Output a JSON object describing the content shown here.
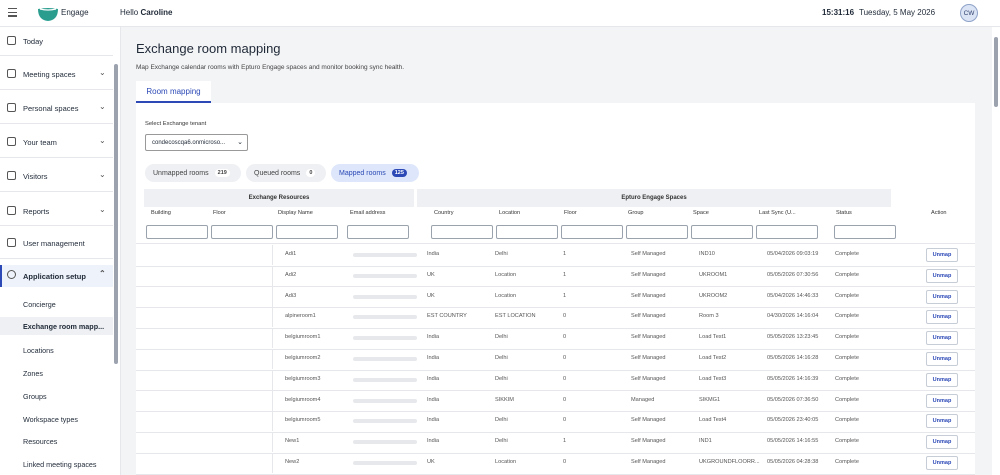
{
  "header": {
    "brand": "Engage",
    "greeting": "Hello",
    "user_name": "Caroline",
    "time": "15:31:16",
    "date": "Tuesday, 5 May 2026",
    "avatar_initials": "CW",
    "accent": "#2c49b6",
    "logo_color": "#2a9d8f"
  },
  "sidebar": {
    "items": [
      {
        "label": "Today",
        "icon": "calendar-icon",
        "chev": ""
      },
      {
        "label": "Meeting spaces",
        "icon": "door-icon",
        "chev": "⌄"
      },
      {
        "label": "Personal spaces",
        "icon": "desk-icon",
        "chev": "⌄"
      },
      {
        "label": "Your team",
        "icon": "team-icon",
        "chev": "⌄"
      },
      {
        "label": "Visitors",
        "icon": "visitor-icon",
        "chev": "⌄"
      },
      {
        "label": "Reports",
        "icon": "report-icon",
        "chev": "⌄"
      },
      {
        "label": "User management",
        "icon": "user-icon",
        "chev": ""
      },
      {
        "label": "Application setup",
        "icon": "gear-icon",
        "chev": "⌃"
      }
    ],
    "sub_items": [
      "Concierge",
      "Exchange room mapp...",
      "Locations",
      "Zones",
      "Groups",
      "Workspace types",
      "Resources",
      "Linked meeting spaces"
    ]
  },
  "page": {
    "title": "Exchange room mapping",
    "subtitle": "Map Exchange calendar rooms with Epturo Engage spaces and monitor booking sync health.",
    "tab": "Room mapping"
  },
  "tenant": {
    "label": "Select Exchange tenant",
    "value": "condecoscqa6.onmicroso..."
  },
  "pills": [
    {
      "label": "Unmapped rooms",
      "count": "219"
    },
    {
      "label": "Queued rooms",
      "count": "0"
    },
    {
      "label": "Mapped rooms",
      "count": "125"
    }
  ],
  "groups": {
    "left": "Exchange Resources",
    "right": "Epturo Engage Spaces"
  },
  "columns": [
    "Building",
    "Floor",
    "Display Name",
    "Email address",
    "Country",
    "Location",
    "Floor",
    "Group",
    "Space",
    "Last Sync (U...",
    "Status",
    "Action"
  ],
  "action_label": "Unmap",
  "rows": [
    {
      "name": "Adi1",
      "country": "India",
      "location": "Delhi",
      "floor": "1",
      "group": "Self Managed",
      "space": "IND10",
      "sync": "05/04/2026 09:03:19",
      "status": "Complete"
    },
    {
      "name": "Adi2",
      "country": "UK",
      "location": "Location",
      "floor": "1",
      "group": "Self Managed",
      "space": "UKROOM1",
      "sync": "05/05/2026 07:30:56",
      "status": "Complete"
    },
    {
      "name": "Adi3",
      "country": "UK",
      "location": "Location",
      "floor": "1",
      "group": "Self Managed",
      "space": "UKROOM2",
      "sync": "05/04/2026 14:46:33",
      "status": "Complete"
    },
    {
      "name": "alpineroom1",
      "country": "EST COUNTRY",
      "location": "EST LOCATION",
      "floor": "0",
      "group": "Self Managed",
      "space": "Room 3",
      "sync": "04/30/2026 14:16:04",
      "status": "Complete"
    },
    {
      "name": "belgiumroom1",
      "country": "India",
      "location": "Delhi",
      "floor": "0",
      "group": "Self Managed",
      "space": "Load Test1",
      "sync": "05/05/2026 13:23:45",
      "status": "Complete"
    },
    {
      "name": "belgiumroom2",
      "country": "India",
      "location": "Delhi",
      "floor": "0",
      "group": "Self Managed",
      "space": "Load Test2",
      "sync": "05/05/2026 14:16:28",
      "status": "Complete"
    },
    {
      "name": "belgiumroom3",
      "country": "India",
      "location": "Delhi",
      "floor": "0",
      "group": "Self Managed",
      "space": "Load Test3",
      "sync": "05/05/2026 14:16:39",
      "status": "Complete"
    },
    {
      "name": "belgiumroom4",
      "country": "India",
      "location": "SIKKIM",
      "floor": "0",
      "group": "Managed",
      "space": "SIKMG1",
      "sync": "05/05/2026 07:36:50",
      "status": "Complete"
    },
    {
      "name": "belgiumroom5",
      "country": "India",
      "location": "Delhi",
      "floor": "0",
      "group": "Self Managed",
      "space": "Load Test4",
      "sync": "05/05/2026 23:40:05",
      "status": "Complete"
    },
    {
      "name": "New1",
      "country": "India",
      "location": "Delhi",
      "floor": "1",
      "group": "Self Managed",
      "space": "IND1",
      "sync": "05/05/2026 14:16:55",
      "status": "Complete"
    },
    {
      "name": "New2",
      "country": "UK",
      "location": "Location",
      "floor": "0",
      "group": "Self Managed",
      "space": "UKGROUNDFLOORR...",
      "sync": "05/05/2026 04:28:38",
      "status": "Complete"
    }
  ]
}
